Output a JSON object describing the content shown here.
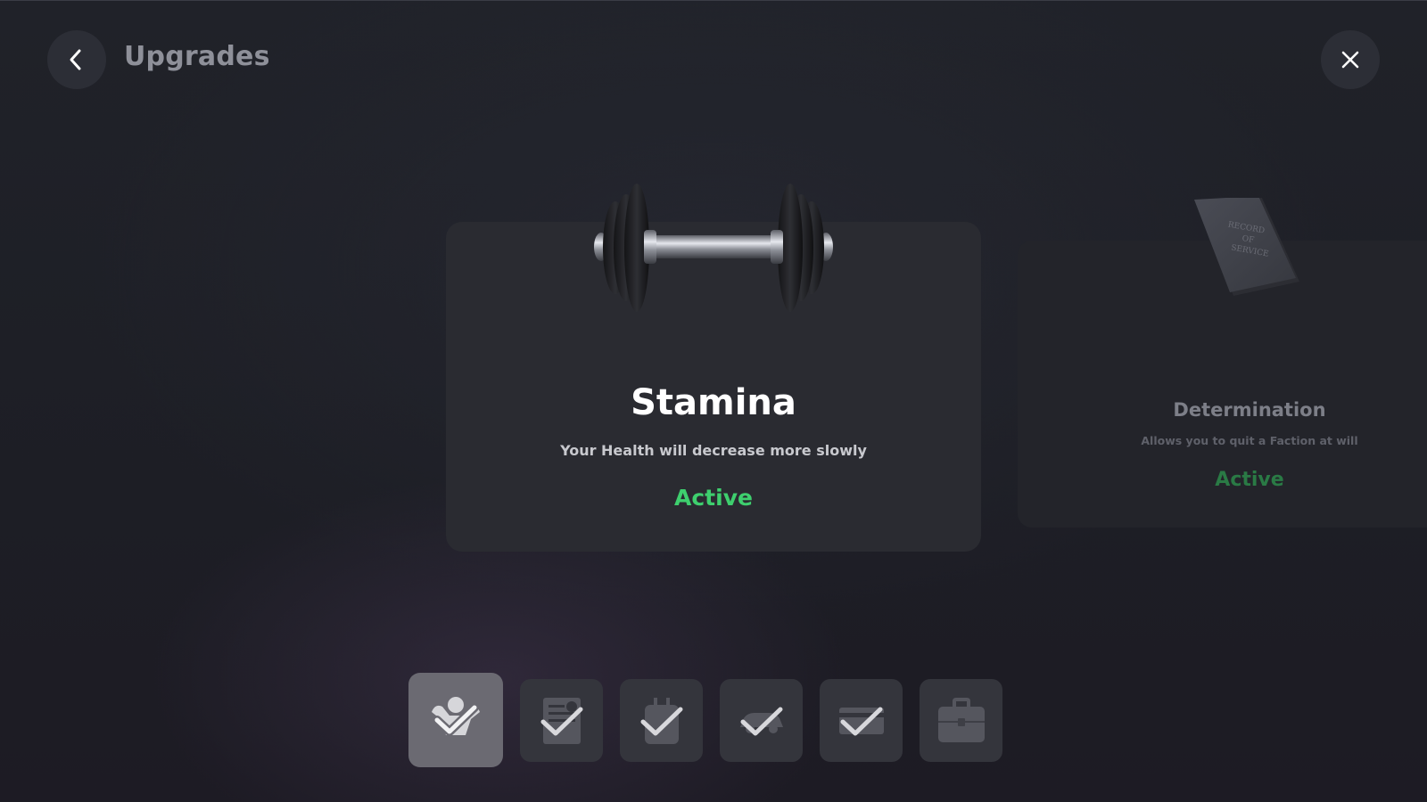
{
  "header": {
    "title": "Upgrades",
    "back_icon": "chevron-left-icon",
    "close_icon": "close-icon"
  },
  "featured_card": {
    "title": "Stamina",
    "description": "Your Health will decrease more slowly",
    "status": "Active",
    "image": "dumbbell"
  },
  "side_card": {
    "title": "Determination",
    "description": "Allows you to quit a Faction at will",
    "status": "Active",
    "image": "record-of-service-book",
    "book_text": [
      "RECORD",
      "OF",
      "SERVICE"
    ]
  },
  "slots": [
    {
      "icon": "strongman-icon",
      "selected": true,
      "completed": true
    },
    {
      "icon": "document-icon",
      "selected": false,
      "completed": true
    },
    {
      "icon": "backpack-icon",
      "selected": false,
      "completed": true
    },
    {
      "icon": "car-icon",
      "selected": false,
      "completed": true
    },
    {
      "icon": "card-icon",
      "selected": false,
      "completed": true
    },
    {
      "icon": "briefcase-icon",
      "selected": false,
      "completed": false
    }
  ],
  "colors": {
    "active_green": "#3ecf6e",
    "card_bg": "#2a2b31",
    "slot_bg": "#34353c",
    "slot_selected_bg": "#6b6a72"
  }
}
